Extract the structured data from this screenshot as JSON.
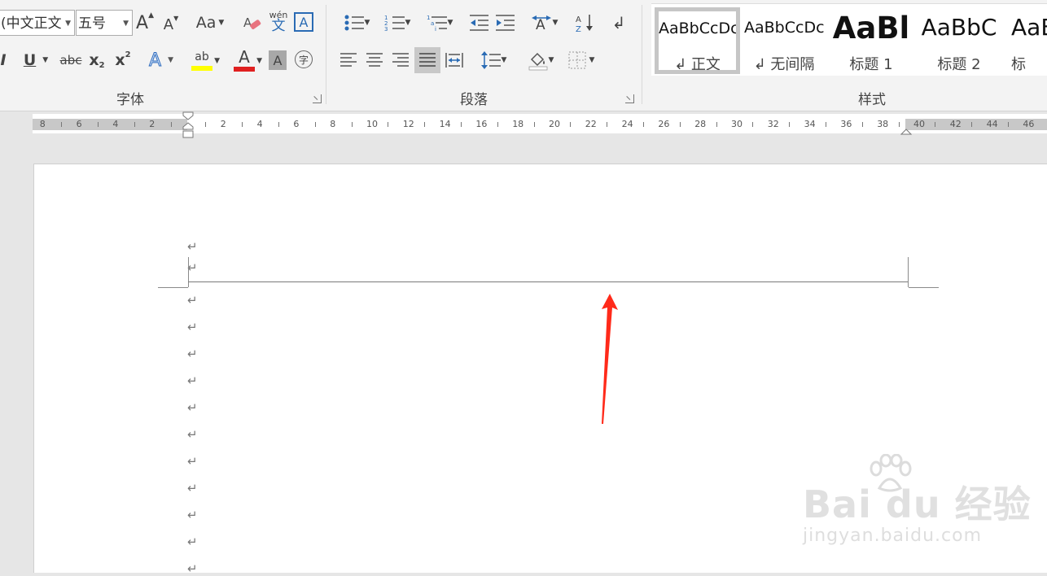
{
  "font_group": {
    "label": "字体",
    "font_name": "(中文正文",
    "font_size": "五号",
    "grow_label": "A",
    "shrink_label": "A",
    "case_label": "Aa",
    "phonetic_top": "wén",
    "phonetic_bottom": "文",
    "border_char_label": "A",
    "italic_label": "I",
    "underline_label": "U",
    "strike_label": "abc",
    "sub_label": "x",
    "sub_mark": "2",
    "sup_label": "x",
    "sup_mark": "2",
    "effects_label": "A",
    "highlight_label": "ab",
    "highlight_color": "#ffff00",
    "fontcolor_label": "A",
    "fontcolor_color": "#e02020",
    "shading_label": "A",
    "enclose_label": "字"
  },
  "paragraph_group": {
    "label": "段落"
  },
  "styles_group": {
    "label": "样式",
    "items": [
      {
        "sample": "AaBbCcDc",
        "name": "↲ 正文"
      },
      {
        "sample": "AaBbCcDc",
        "name": "↲ 无间隔"
      },
      {
        "sample": "AaBl",
        "name": "标题 1"
      },
      {
        "sample": "AaBbC",
        "name": "标题 2"
      },
      {
        "sample": "AaB",
        "name": "标"
      }
    ]
  },
  "ruler": {
    "left_numbers": [
      "8",
      "6",
      "4",
      "2"
    ],
    "right_numbers": [
      "2",
      "4",
      "6",
      "8",
      "10",
      "12",
      "14",
      "16",
      "18",
      "20",
      "22",
      "24",
      "26",
      "28",
      "30",
      "32",
      "34",
      "36",
      "38",
      "40",
      "42",
      "44",
      "46"
    ]
  },
  "document": {
    "paragraph_mark": "↵"
  },
  "annotation": {
    "arrow_color": "#ff2a1a"
  },
  "watermark": {
    "brand": "Bai du 经验",
    "url": "jingyan.baidu.com"
  },
  "colors": {
    "ribbon_bg": "#f3f3f3",
    "page_bg": "#ffffff",
    "workspace_bg": "#e6e6e6"
  }
}
